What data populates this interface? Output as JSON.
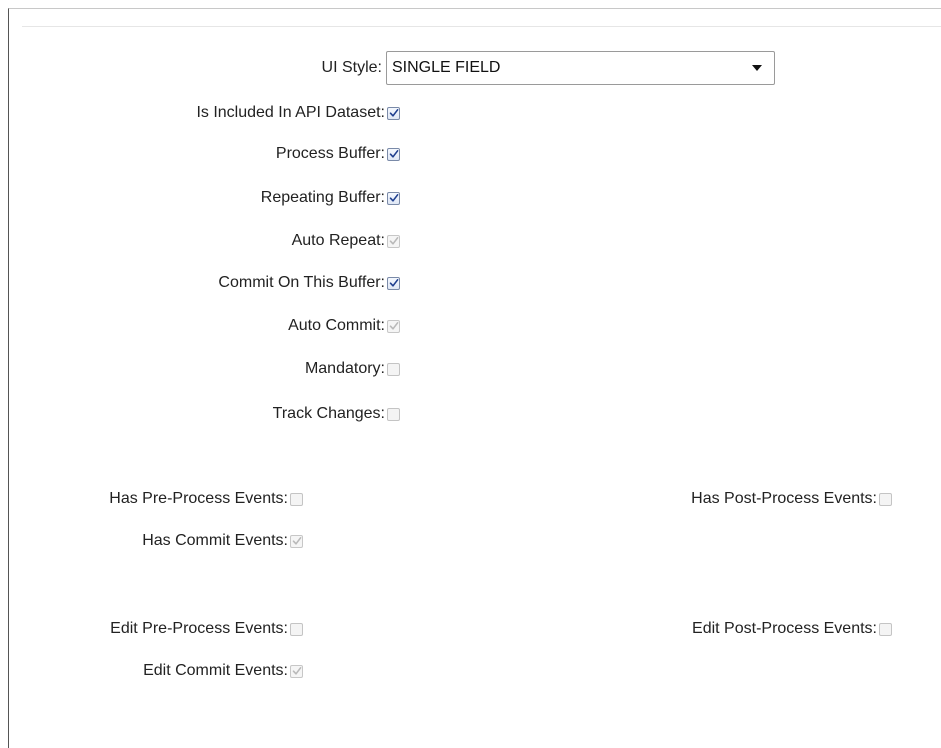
{
  "ui_style": {
    "label": "UI Style:",
    "selected": "SINGLE FIELD",
    "icon": "chevron-down-icon"
  },
  "buffer_options": [
    {
      "label": "Is Included In API Dataset:",
      "state": "checked"
    },
    {
      "label": "Process Buffer:",
      "state": "checked"
    },
    {
      "label": "Repeating Buffer:",
      "state": "checked"
    },
    {
      "label": "Auto Repeat:",
      "state": "checked-disabled"
    },
    {
      "label": "Commit On This Buffer:",
      "state": "checked"
    },
    {
      "label": "Auto Commit:",
      "state": "checked-disabled"
    },
    {
      "label": "Mandatory:",
      "state": "unchecked"
    },
    {
      "label": "Track Changes:",
      "state": "unchecked"
    }
  ],
  "events": {
    "has_pre_process": {
      "label": "Has Pre-Process Events:",
      "state": "unchecked"
    },
    "has_post_process": {
      "label": "Has Post-Process Events:",
      "state": "unchecked"
    },
    "has_commit": {
      "label": "Has Commit Events:",
      "state": "checked-disabled"
    },
    "edit_pre_process": {
      "label": "Edit Pre-Process Events:",
      "state": "unchecked"
    },
    "edit_post_process": {
      "label": "Edit Post-Process Events:",
      "state": "unchecked"
    },
    "edit_commit": {
      "label": "Edit Commit Events:",
      "state": "checked-disabled"
    }
  },
  "colors": {
    "check_active": "#1f3f8f",
    "check_disabled": "#b9b9b9"
  }
}
